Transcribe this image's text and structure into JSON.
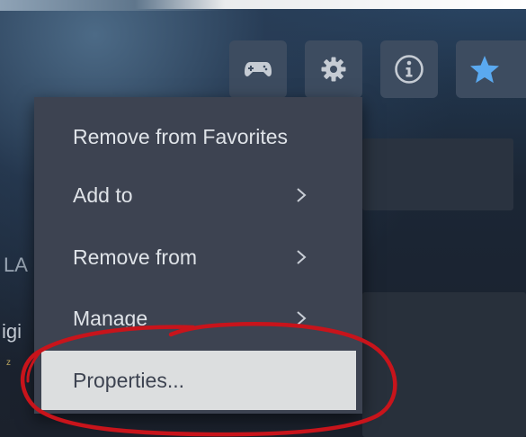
{
  "toolbar": {
    "buttons": [
      {
        "icon": "controller-icon"
      },
      {
        "icon": "gear-icon"
      },
      {
        "icon": "info-icon"
      },
      {
        "icon": "star-icon",
        "active_color": "#5aa9f0"
      }
    ]
  },
  "background": {
    "left_fragments": [
      "LA",
      "igi",
      "z"
    ]
  },
  "context_menu": {
    "items": [
      {
        "label": "Remove from Favorites",
        "has_submenu": false
      },
      {
        "label": "Add to",
        "has_submenu": true
      },
      {
        "label": "Remove from",
        "has_submenu": true
      },
      {
        "label": "Manage",
        "has_submenu": true
      },
      {
        "label": "Properties...",
        "has_submenu": false,
        "highlighted": true
      }
    ]
  },
  "colors": {
    "menu_bg": "#3d4351",
    "menu_text": "#dfe3e8",
    "highlight_bg": "#dcdedf",
    "annotation": "#c8141b"
  }
}
